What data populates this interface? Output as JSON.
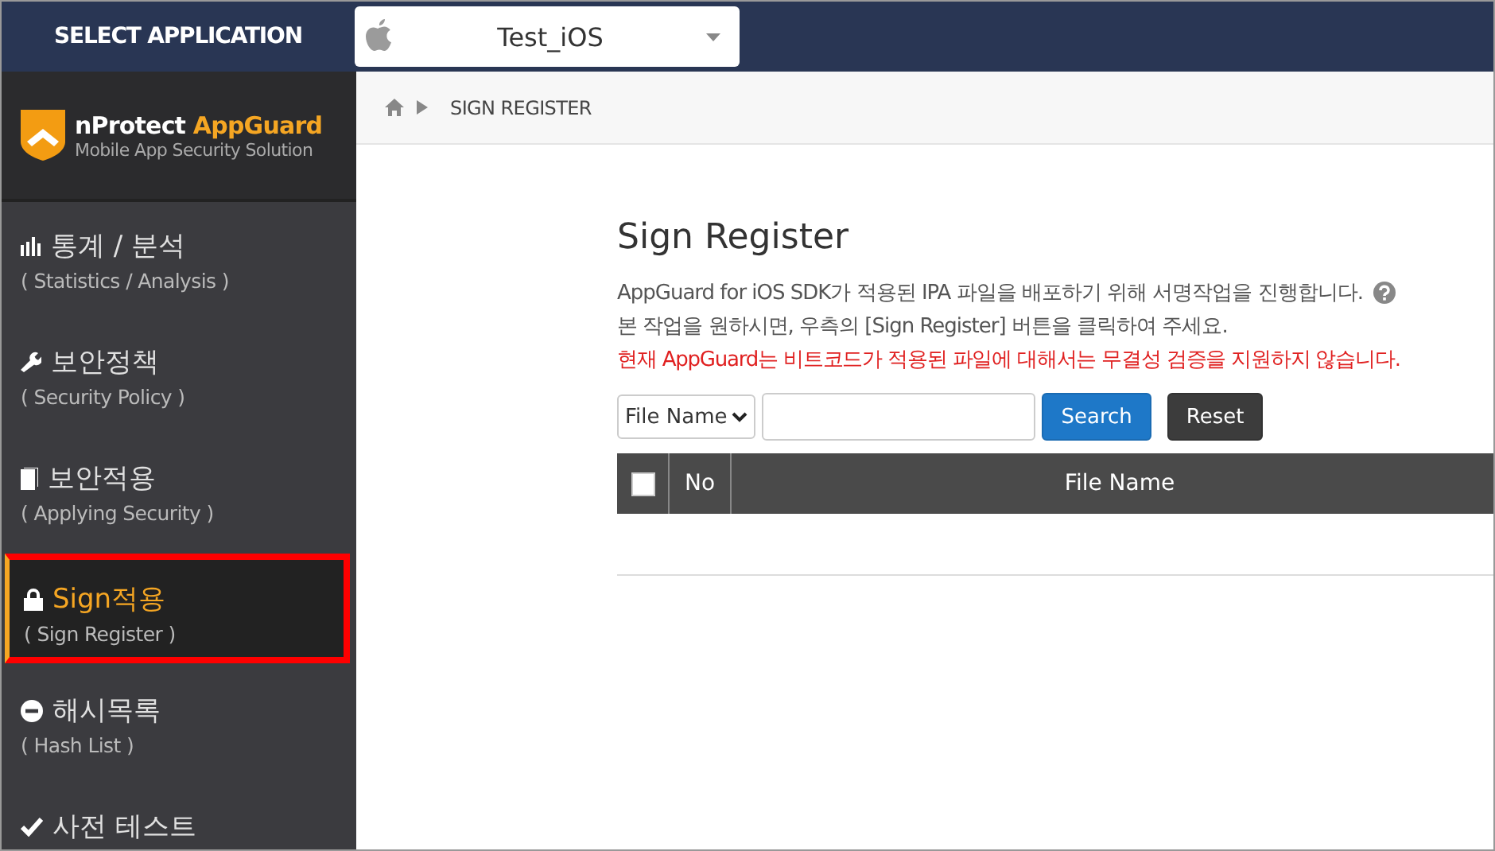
{
  "topbar": {
    "title": "SELECT APPLICATION",
    "app_select": {
      "value": "Test_iOS"
    }
  },
  "logo": {
    "name_plain": "nProtect",
    "name_accent": "AppGuard",
    "tagline": "Mobile App Security Solution"
  },
  "sidebar": {
    "items": [
      {
        "kind": "chart",
        "label": "통계 / 분석",
        "sublabel": "( Statistics / Analysis )",
        "selected": false
      },
      {
        "kind": "wrench",
        "label": "보안정책",
        "sublabel": "( Security Policy )",
        "selected": false
      },
      {
        "kind": "document",
        "label": "보안적용",
        "sublabel": "( Applying Security )",
        "selected": false
      },
      {
        "kind": "lock",
        "label": "Sign적용",
        "sublabel": "( Sign Register )",
        "selected": true
      },
      {
        "kind": "minus",
        "label": "해시목록",
        "sublabel": "( Hash List )",
        "selected": false
      },
      {
        "kind": "check",
        "label": "사전 테스트",
        "selected": false
      }
    ]
  },
  "breadcrumb": {
    "label": "SIGN REGISTER"
  },
  "page": {
    "title": "Sign Register",
    "description": [
      "AppGuard for iOS SDK가 적용된 IPA 파일을 배포하기 위해 서명작업을 진행합니다.",
      "본 작업을 원하시면, 우측의 [Sign Register] 버튼을 클릭하여 주세요."
    ],
    "warning": "현재 AppGuard는 비트코드가 적용된 파일에 대해서는 무결성 검증을 지원하지 않습니다.",
    "search": {
      "filter": "File Name",
      "search_button": "Search",
      "reset_button": "Reset"
    },
    "table": {
      "select_all_checked": false,
      "columns": [
        "No",
        "File Name"
      ]
    }
  }
}
